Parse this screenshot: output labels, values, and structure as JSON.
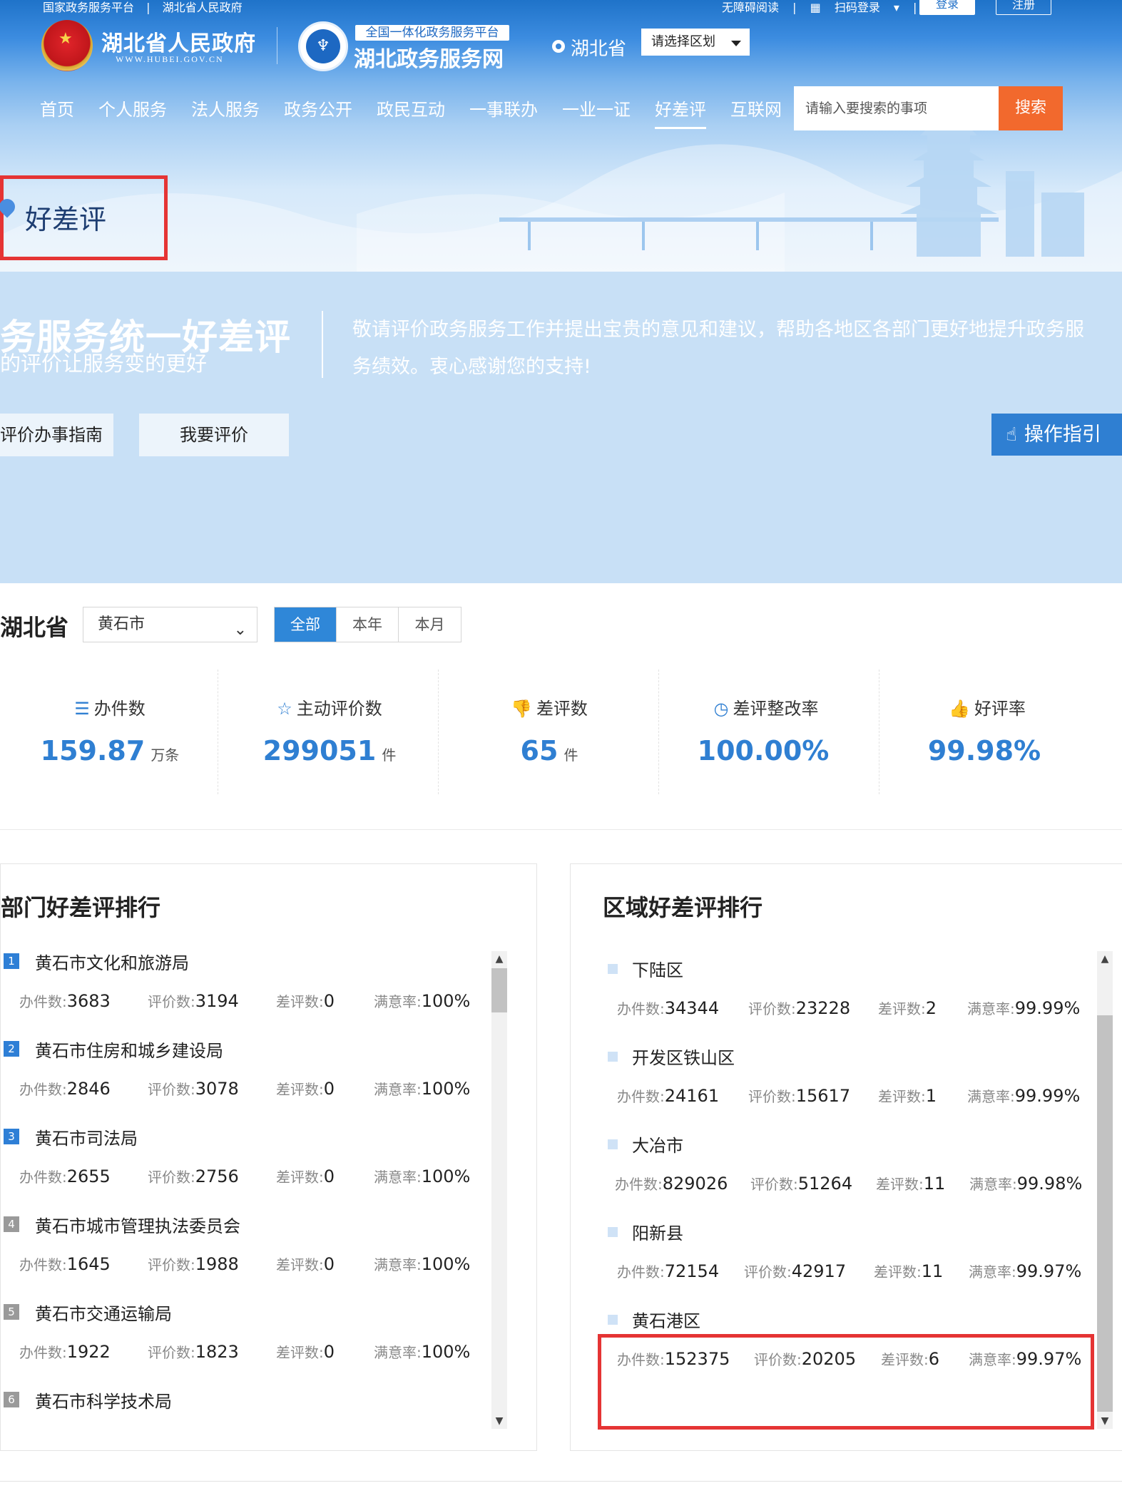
{
  "topbar": {
    "links_left": [
      "国家政务服务平台",
      "湖北省人民政府"
    ],
    "links_right": [
      "无障碍阅读",
      "扫码登录"
    ],
    "login": "登录",
    "register": "注册"
  },
  "brand": {
    "gov_name": "湖北省人民政府",
    "gov_url": "WWW.HUBEI.GOV.CN",
    "platform_tag": "全国一体化政务服务平台",
    "site_name": "湖北政务服务网"
  },
  "location": {
    "province": "湖北省",
    "region_placeholder": "请选择区划"
  },
  "nav": {
    "items": [
      "首页",
      "个人服务",
      "法人服务",
      "政务公开",
      "政民互动",
      "一事联办",
      "一业一证",
      "好差评",
      "互联网"
    ],
    "active_index": 7
  },
  "search": {
    "placeholder": "请输入要搜索的事项",
    "button": "搜索"
  },
  "page_title": "好差评",
  "banner": {
    "title": "务服务统一好差评",
    "subtitle": "的评价让服务变的更好",
    "description": "敬请评价政务服务工作并提出宝贵的意见和建议，帮助各地区各部门更好地提升政务服务绩效。衷心感谢您的支持!",
    "btn_guide": "评价办事指南",
    "btn_rate": "我要评价",
    "btn_operation": "操作指引"
  },
  "filter": {
    "province": "湖北省",
    "city": "黄石市",
    "periods": [
      "全部",
      "本年",
      "本月"
    ],
    "active_period": 0
  },
  "stats": [
    {
      "icon": "document-list-icon",
      "label": "办件数",
      "value": "159.87",
      "unit": "万条"
    },
    {
      "icon": "star-icon",
      "label": "主动评价数",
      "value": "299051",
      "unit": "件"
    },
    {
      "icon": "thumbs-down-icon",
      "label": "差评数",
      "value": "65",
      "unit": "件"
    },
    {
      "icon": "clock-icon",
      "label": "差评整改率",
      "value": "100.00%",
      "unit": ""
    },
    {
      "icon": "thumbs-up-icon",
      "label": "好评率",
      "value": "99.98%",
      "unit": ""
    }
  ],
  "metric_labels": {
    "handled": "办件数:",
    "rated": "评价数:",
    "bad": "差评数:",
    "satisfaction": "满意率:"
  },
  "dept_ranking": {
    "title": "部门好差评排行",
    "items": [
      {
        "rank": "1",
        "name": "黄石市文化和旅游局",
        "handled": "3683",
        "rated": "3194",
        "bad": "0",
        "satisfaction": "100%"
      },
      {
        "rank": "2",
        "name": "黄石市住房和城乡建设局",
        "handled": "2846",
        "rated": "3078",
        "bad": "0",
        "satisfaction": "100%"
      },
      {
        "rank": "3",
        "name": "黄石市司法局",
        "handled": "2655",
        "rated": "2756",
        "bad": "0",
        "satisfaction": "100%"
      },
      {
        "rank": "4",
        "name": "黄石市城市管理执法委员会",
        "handled": "1645",
        "rated": "1988",
        "bad": "0",
        "satisfaction": "100%"
      },
      {
        "rank": "5",
        "name": "黄石市交通运输局",
        "handled": "1922",
        "rated": "1823",
        "bad": "0",
        "satisfaction": "100%"
      },
      {
        "rank": "6",
        "name": "黄石市科学技术局"
      }
    ]
  },
  "region_ranking": {
    "title": "区域好差评排行",
    "items": [
      {
        "name": "下陆区",
        "handled": "34344",
        "rated": "23228",
        "bad": "2",
        "satisfaction": "99.99%"
      },
      {
        "name": "开发区铁山区",
        "handled": "24161",
        "rated": "15617",
        "bad": "1",
        "satisfaction": "99.99%"
      },
      {
        "name": "大冶市",
        "handled": "829026",
        "rated": "51264",
        "bad": "11",
        "satisfaction": "99.98%"
      },
      {
        "name": "阳新县",
        "handled": "72154",
        "rated": "42917",
        "bad": "11",
        "satisfaction": "99.97%"
      },
      {
        "name": "黄石港区",
        "handled": "152375",
        "rated": "20205",
        "bad": "6",
        "satisfaction": "99.97%"
      }
    ]
  },
  "colors": {
    "primary": "#2f7fd2",
    "search_button": "#f2692d",
    "highlight_box": "#e53434"
  }
}
